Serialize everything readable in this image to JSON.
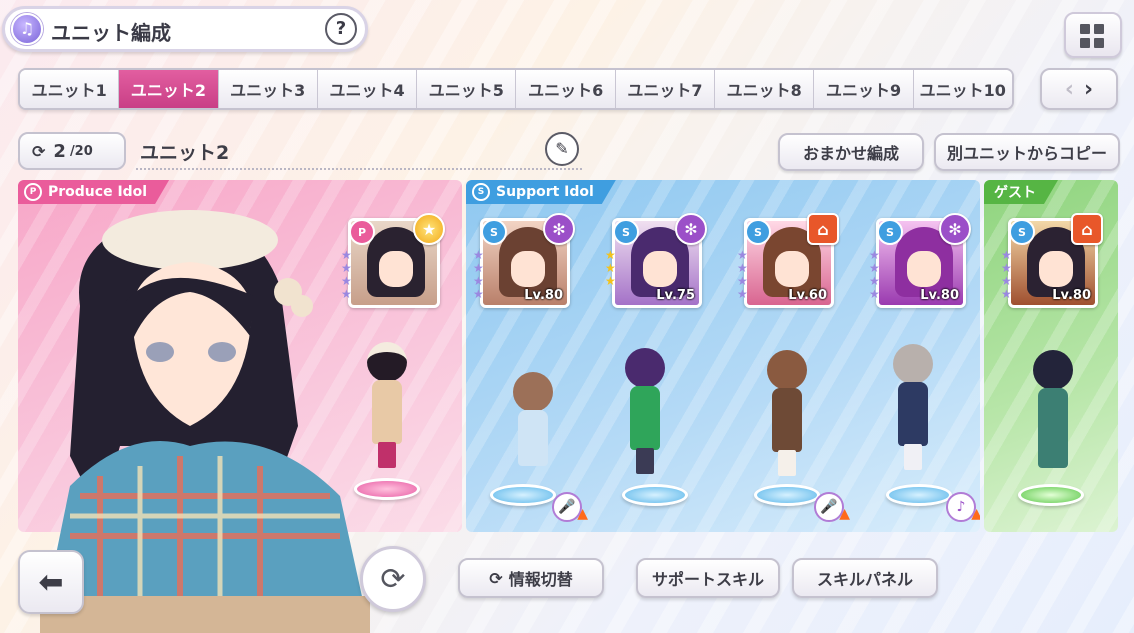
{
  "header": {
    "title": "ユニット編成",
    "help_label": "?"
  },
  "tabs": [
    {
      "label": "ユニット1"
    },
    {
      "label": "ユニット2"
    },
    {
      "label": "ユニット3"
    },
    {
      "label": "ユニット4"
    },
    {
      "label": "ユニット5"
    },
    {
      "label": "ユニット6"
    },
    {
      "label": "ユニット7"
    },
    {
      "label": "ユニット8"
    },
    {
      "label": "ユニット9"
    },
    {
      "label": "ユニット10"
    }
  ],
  "active_tab": "ユニット2",
  "nav": {
    "prev": "‹",
    "next": "›"
  },
  "unit": {
    "count_current": "2",
    "count_total": "/20",
    "name": "ユニット2"
  },
  "buttons": {
    "auto_form": "おまかせ編成",
    "copy_from": "別ユニットからコピー",
    "info_switch": "情報切替",
    "support_skill": "サポートスキル",
    "skill_panel": "スキルパネル"
  },
  "panels": {
    "produce": {
      "label": "Produce Idol"
    },
    "support": {
      "label": "Support Idol"
    },
    "guest": {
      "label": "ゲスト"
    }
  },
  "produce_card": {
    "type": "P"
  },
  "support_cards": [
    {
      "level": "Lv.80",
      "skill": "gear"
    },
    {
      "level": "Lv.75",
      "skill": "gear"
    },
    {
      "level": "Lv.60",
      "skill": "school"
    },
    {
      "level": "Lv.80",
      "skill": "gear"
    }
  ],
  "guest_card": {
    "level": "Lv.80",
    "skill": "school"
  },
  "colors": {
    "active_tab": "#d24c92",
    "produce": "#ea5c9b",
    "support": "#3f9ee0",
    "guest": "#56b544"
  }
}
